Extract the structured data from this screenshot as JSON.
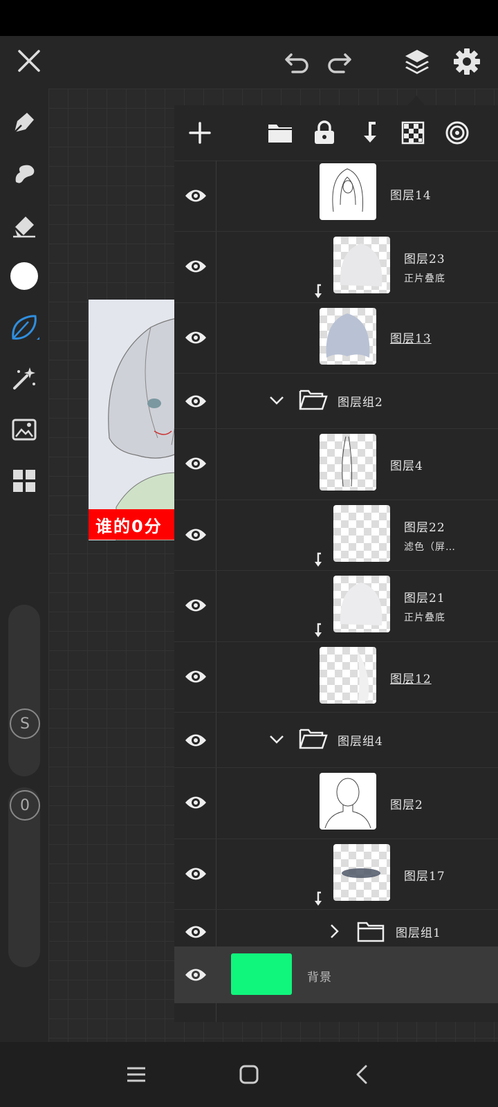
{
  "topbar": {
    "close_icon": "close-icon",
    "undo_icon": "undo-icon",
    "redo_icon": "redo-icon",
    "layers_icon": "layers-icon",
    "settings_icon": "gear-icon"
  },
  "left_tools": [
    "pen-icon",
    "smudge-icon",
    "eraser-icon",
    "color-swatch",
    "brush-icon",
    "magic-wand-icon",
    "image-import-icon",
    "gallery-icon"
  ],
  "brush_size_label": "S",
  "opacity_label": "0",
  "canvas": {
    "caption": "谁的0分"
  },
  "layers_panel": {
    "toolbar": [
      "add-icon",
      "folder-icon",
      "lock-icon",
      "merge-down-icon",
      "transparency-icon",
      "target-icon"
    ],
    "layers": [
      {
        "name": "图层14",
        "sub": ""
      },
      {
        "name": "图层23",
        "sub": "正片叠底"
      },
      {
        "name": "图层13",
        "sub": ""
      },
      {
        "name": "图层组2",
        "sub": ""
      },
      {
        "name": "图层4",
        "sub": ""
      },
      {
        "name": "图层22",
        "sub": "滤色（屏…"
      },
      {
        "name": "图层21",
        "sub": "正片叠底"
      },
      {
        "name": "图层12",
        "sub": ""
      },
      {
        "name": "图层组4",
        "sub": ""
      },
      {
        "name": "图层2",
        "sub": ""
      },
      {
        "name": "图层17",
        "sub": ""
      },
      {
        "name": "图层组1",
        "sub": ""
      }
    ],
    "background": {
      "name": "背景",
      "color": "#10f57c"
    }
  },
  "navbar": {
    "menu_icon": "recent-apps-icon",
    "home_icon": "home-icon",
    "back_icon": "back-icon"
  }
}
